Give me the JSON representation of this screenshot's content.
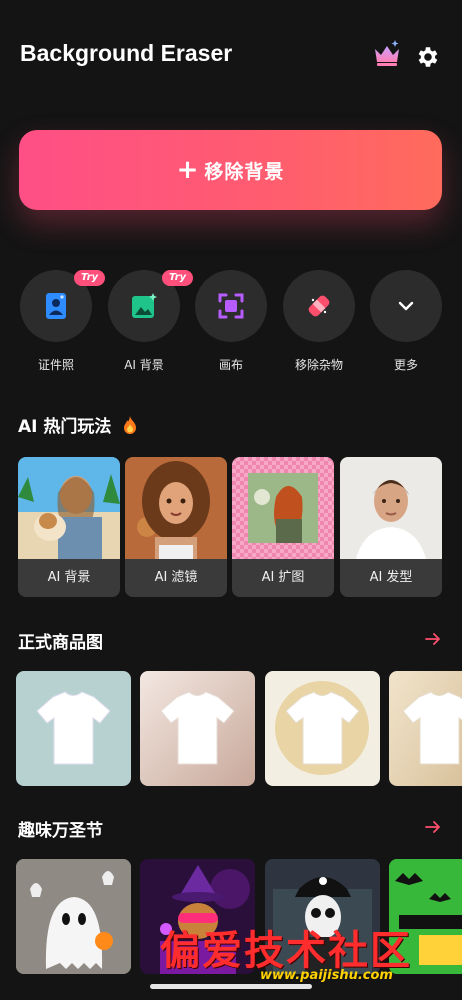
{
  "header": {
    "title": "Background Eraser",
    "crown_icon": "crown-icon",
    "settings_icon": "gear-icon"
  },
  "primary_action": {
    "plus": "+",
    "label": "移除背景"
  },
  "tools": [
    {
      "label": "证件照",
      "icon": "id-photo-icon",
      "badge": "Try"
    },
    {
      "label": "AI 背景",
      "icon": "ai-background-icon",
      "badge": "Try"
    },
    {
      "label": "画布",
      "icon": "canvas-frame-icon"
    },
    {
      "label": "移除杂物",
      "icon": "eraser-icon"
    },
    {
      "label": "更多",
      "icon": "chevron-down-icon"
    }
  ],
  "sections": {
    "ai_hot": {
      "title": "AI 热门玩法",
      "icon": "fire-icon",
      "cards": [
        {
          "label": "AI 背景"
        },
        {
          "label": "AI 滤镜"
        },
        {
          "label": "AI 扩图"
        },
        {
          "label": "AI 发型"
        }
      ]
    },
    "products": {
      "title": "正式商品图",
      "arrow_icon": "arrow-right-icon"
    },
    "halloween": {
      "title": "趣味万圣节",
      "arrow_icon": "arrow-right-icon"
    }
  },
  "watermark": {
    "text": "偏爱技术社区",
    "url": "www.paijishu.com"
  },
  "colors": {
    "accent": "#ff4f7b",
    "background": "#141414",
    "card": "#2c2c2c"
  }
}
